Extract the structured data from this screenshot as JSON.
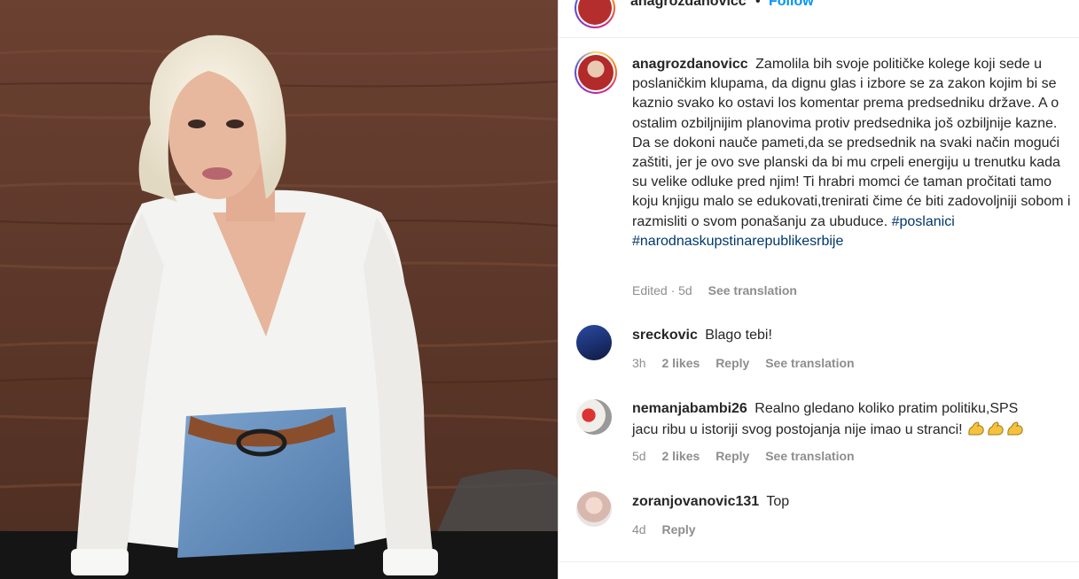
{
  "post": {
    "username": "anagrozdanovicc",
    "follow_label": "Follow",
    "dot": "•",
    "more_label": "···"
  },
  "caption": {
    "username": "anagrozdanovicc",
    "text": "Zamolila bih svoje političke kolege koji sede u poslaničkim klupama, da dignu glas i izbore se za zakon kojim bi se kaznio svako ko ostavi los komentar prema predsedniku države. A o ostalim ozbiljnijim planovima protiv predsednika još ozbiljnije kazne. Da se dokoni nauče pameti,da se predsednik na svaki način mogući zaštiti, jer je ovo sve planski da bi mu crpeli energiju u trenutku kada su velike odluke pred njim! Ti hrabri momci će taman pročitati tamo koju knjigu malo se edukovati,trenirati čime će biti zadovoljniji sobom i razmisliti o svom ponašanju za ubuduce.",
    "hashtag1": "#poslanici",
    "hashtag2": "#narodnaskupstinarepublikesrbije",
    "meta_time": "Edited · 5d",
    "see_translation": "See translation"
  },
  "comments": [
    {
      "username": "sreckovic",
      "text": "Blago tebi!",
      "time": "3h",
      "likes": "2 likes",
      "reply": "Reply",
      "see_translation": "See translation"
    },
    {
      "username": "nemanjabambi26",
      "text_line1": "Realno gledano koliko pratim politiku,SPS",
      "text_line2": "jacu ribu u istoriji svog postojanja nije imao u stranci!",
      "emoji": "flexed-biceps-emoji",
      "time": "5d",
      "likes": "2 likes",
      "reply": "Reply",
      "see_translation": "See translation"
    },
    {
      "username": "zoranjovanovic131",
      "text": "Top",
      "time": "4d",
      "reply": "Reply"
    }
  ],
  "colors": {
    "link": "#00376b",
    "follow": "#0095f6",
    "muted": "#8e8e8e",
    "text": "#262626"
  }
}
